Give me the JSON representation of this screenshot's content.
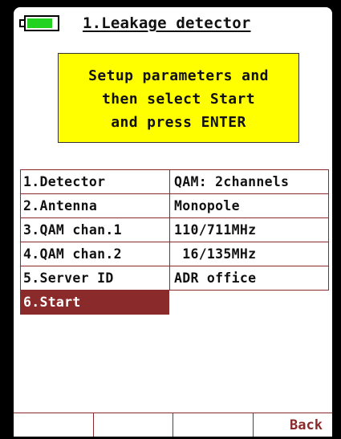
{
  "header": {
    "title": "1.Leakage detector",
    "battery": {
      "level": 0.85,
      "color": "#22d322"
    }
  },
  "message": {
    "lines": [
      "Setup parameters and",
      "then select Start",
      "and press ENTER"
    ],
    "background": "#ffff00"
  },
  "params": [
    {
      "label": "1.Detector",
      "value": "QAM: 2channels"
    },
    {
      "label": "2.Antenna",
      "value": "Monopole"
    },
    {
      "label": "3.QAM chan.1",
      "value": "110/711MHz"
    },
    {
      "label": "4.QAM chan.2",
      "value": " 16/135MHz"
    },
    {
      "label": "5.Server ID",
      "value": "ADR office"
    },
    {
      "label": "6.Start",
      "value": "",
      "selected": true
    }
  ],
  "softkeys": [
    "",
    "",
    "",
    "Back"
  ],
  "colors": {
    "accent": "#8b2a2a",
    "selected_text": "#ffffff"
  }
}
